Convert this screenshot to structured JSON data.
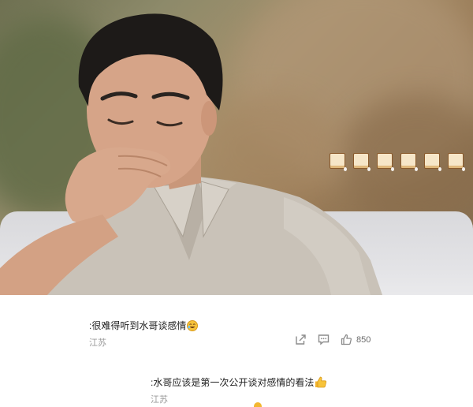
{
  "video": {
    "emoji_overlay": [
      "bread-icon",
      "bread-icon",
      "bread-icon",
      "bread-icon",
      "bread-icon",
      "bread-icon"
    ]
  },
  "comments": [
    {
      "text": ":很难得听到水哥谈感情",
      "emoji": "laughing-face-icon",
      "location": "江苏",
      "actions": {
        "share": "share-icon",
        "reply": "comment-icon",
        "like": "thumbs-up-icon"
      },
      "likes": "850"
    },
    {
      "text": ":水哥应该是第一次公开谈对感情的看法",
      "emoji": "thumbs-up-emoji-icon",
      "location": "江苏"
    }
  ],
  "colors": {
    "meta_text": "#9a9a9a",
    "comment_text": "#1f1f1f",
    "icon_gray": "#8c8c8c"
  }
}
